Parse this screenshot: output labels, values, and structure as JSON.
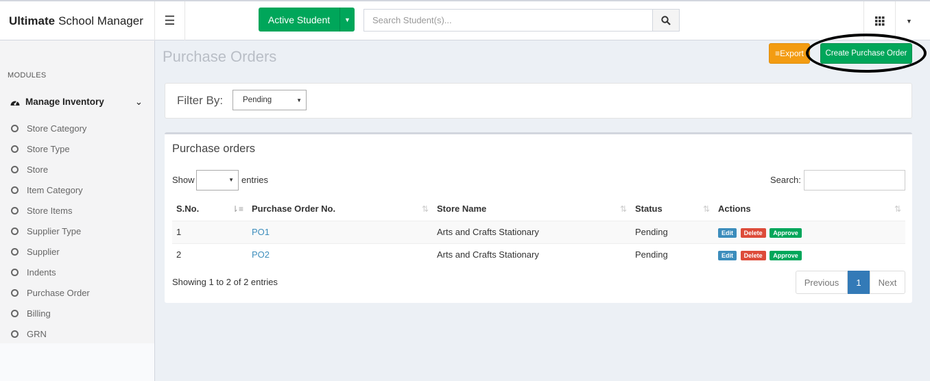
{
  "app": {
    "brand_bold": "Ultimate",
    "brand_rest": "School Manager"
  },
  "topbar": {
    "active_button": "Active Student",
    "search_placeholder": "Search Student(s)...",
    "icons": [
      "menu-icon",
      "search-icon",
      "apps-grid-icon",
      "caret-down-icon"
    ]
  },
  "sidebar": {
    "header": "MODULES",
    "main_item": "Manage Inventory",
    "items": [
      "Store Category",
      "Store Type",
      "Store",
      "Item Category",
      "Store Items",
      "Supplier Type",
      "Supplier",
      "Indents",
      "Purchase Order",
      "Billing",
      "GRN"
    ]
  },
  "page": {
    "title": "Purchase Orders",
    "export_label": "Export",
    "create_label": "Create Purchase Order"
  },
  "filter": {
    "label": "Filter By:",
    "selected": "Pending"
  },
  "table": {
    "title": "Purchase orders",
    "show_label": "Show",
    "entries_label": "entries",
    "search_label": "Search:",
    "columns": [
      "S.No.",
      "Purchase Order No.",
      "Store Name",
      "Status",
      "Actions"
    ],
    "rows": [
      {
        "sno": "1",
        "po": "PO1",
        "store": "Arts and Crafts Stationary",
        "status": "Pending"
      },
      {
        "sno": "2",
        "po": "PO2",
        "store": "Arts and Crafts Stationary",
        "status": "Pending"
      }
    ],
    "actions": {
      "edit": "Edit",
      "delete": "Delete",
      "approve": "Approve"
    },
    "info": "Showing 1 to 2 of 2 entries",
    "pagination": {
      "previous": "Previous",
      "current": "1",
      "next": "Next"
    }
  },
  "colors": {
    "green": "#00a65a",
    "orange": "#f39c12",
    "blue": "#3c8dbc",
    "red": "#dd4b39"
  }
}
